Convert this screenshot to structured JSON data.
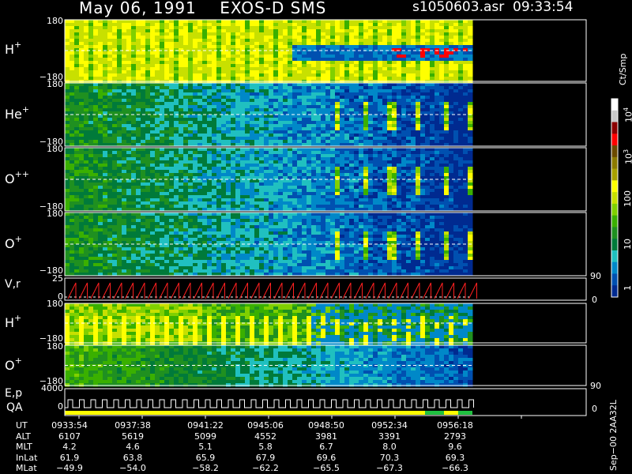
{
  "header": {
    "title": "May 06, 1991    EXOS-D SMS",
    "file_time": "s1050603.asr  09:33:54"
  },
  "panels": [
    {
      "id": "h1",
      "label": "H",
      "sup": "+",
      "ymax": "180",
      "ymin": "−180"
    },
    {
      "id": "he",
      "label": "He",
      "sup": "+",
      "ymax": "180",
      "ymin": "−180"
    },
    {
      "id": "opp",
      "label": "O",
      "sup": "++",
      "ymax": "180",
      "ymin": "−180"
    },
    {
      "id": "op1",
      "label": "O",
      "sup": "+",
      "ymax": "180",
      "ymin": "−180"
    },
    {
      "id": "vr",
      "label": "V,r",
      "ymax": "25",
      "ymin": "0",
      "rmax": "90",
      "rmin": "0"
    },
    {
      "id": "h2",
      "label": "H",
      "sup": "+",
      "ymax": "180",
      "ymin": "−180"
    },
    {
      "id": "o2",
      "label": "O",
      "sup": "+",
      "ymax": "180",
      "ymin": "−180"
    },
    {
      "id": "ep",
      "label": "E,p",
      "ymax": "4000",
      "ymin": "0",
      "rmax": "90",
      "rmin": "0"
    }
  ],
  "qa_label": "QA",
  "colorbar": {
    "unit": "Ct/Smp",
    "ticks": [
      {
        "exp": "4",
        "label": "10"
      },
      {
        "exp": "3",
        "label": "10"
      },
      {
        "label": "100"
      },
      {
        "label": "10"
      },
      {
        "label": "1"
      }
    ],
    "colors": [
      "#ffffff",
      "#c8c8c8",
      "#8b0000",
      "#ff0000",
      "#6b4a00",
      "#8c7a00",
      "#a8a000",
      "#ffff00",
      "#c8e000",
      "#80d000",
      "#3ab000",
      "#1f9020",
      "#007a3a",
      "#20c0c0",
      "#0088c8",
      "#0050b0",
      "#002a90"
    ]
  },
  "footer": {
    "rows": [
      {
        "name": "UT",
        "values": [
          "0933:54",
          "0937:38",
          "0941:22",
          "0945:06",
          "0948:50",
          "0952:34",
          "0956:18"
        ]
      },
      {
        "name": "ALT",
        "values": [
          "6107",
          "5619",
          "5099",
          "4552",
          "3981",
          "3391",
          "2793"
        ]
      },
      {
        "name": "MLT",
        "values": [
          "4.2",
          "4.6",
          "5.1",
          "5.8",
          "6.7",
          "8.0",
          "9.6"
        ]
      },
      {
        "name": "InLat",
        "values": [
          "61.9",
          "63.8",
          "65.9",
          "67.9",
          "69.6",
          "70.3",
          "69.3"
        ]
      },
      {
        "name": "MLat",
        "values": [
          "−49.9",
          "−54.0",
          "−58.2",
          "−62.2",
          "−65.5",
          "−67.3",
          "−66.3"
        ]
      }
    ]
  },
  "side_note": "Sep−00 2AA32L",
  "chart_data": {
    "type": "heatmap",
    "title": "May 06, 1991    EXOS-D SMS",
    "x": [
      "0933:54",
      "0937:38",
      "0941:22",
      "0945:06",
      "0948:50",
      "0952:34",
      "0956:18"
    ],
    "series": [
      {
        "name": "H+",
        "ylim": [
          -180,
          180
        ]
      },
      {
        "name": "He+",
        "ylim": [
          -180,
          180
        ]
      },
      {
        "name": "O++",
        "ylim": [
          -180,
          180
        ]
      },
      {
        "name": "O+",
        "ylim": [
          -180,
          180
        ]
      },
      {
        "name": "V,r",
        "ylim": [
          0,
          25
        ]
      },
      {
        "name": "H+",
        "ylim": [
          -180,
          180
        ]
      },
      {
        "name": "O+",
        "ylim": [
          -180,
          180
        ]
      },
      {
        "name": "E,p",
        "ylim": [
          0,
          4000
        ]
      }
    ],
    "colorbar_label": "Ct/Smp",
    "colorbar_range": [
      1,
      10000
    ],
    "colorbar_scale": "log"
  }
}
